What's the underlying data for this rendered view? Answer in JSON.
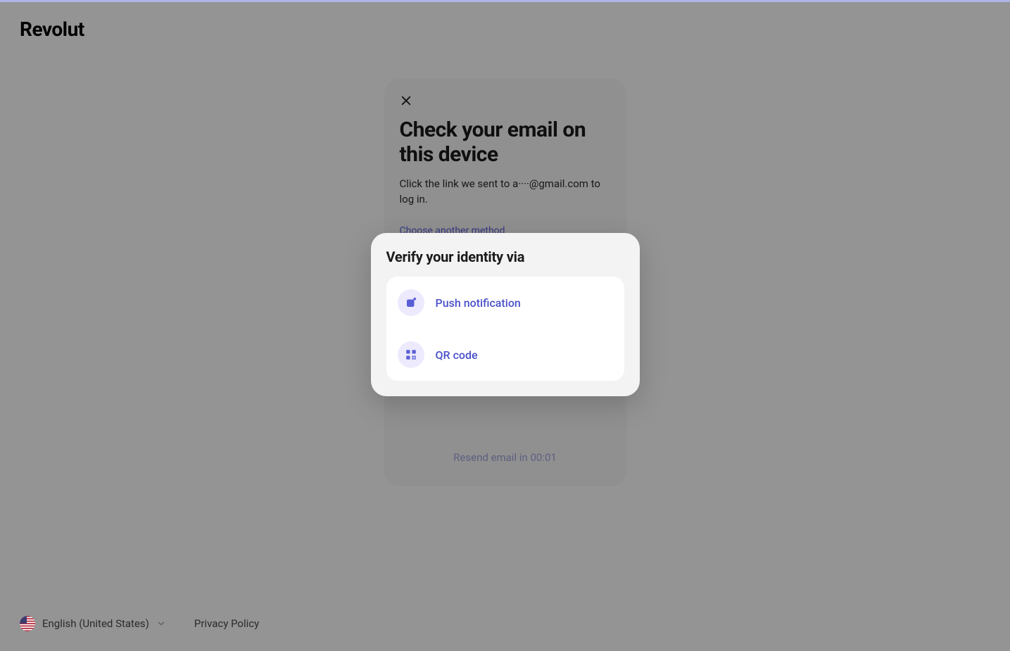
{
  "brand": "Revolut",
  "main": {
    "title": "Check your email on this device",
    "subtitle": "Click the link we sent to a····@gmail.com to log in.",
    "choose_method": "Choose another method",
    "resend_text": "Resend email in 00:01"
  },
  "popup": {
    "title": "Verify your identity via",
    "options": {
      "push": "Push notification",
      "qr": "QR code"
    }
  },
  "footer": {
    "language": "English (United States)",
    "privacy": "Privacy Policy"
  }
}
